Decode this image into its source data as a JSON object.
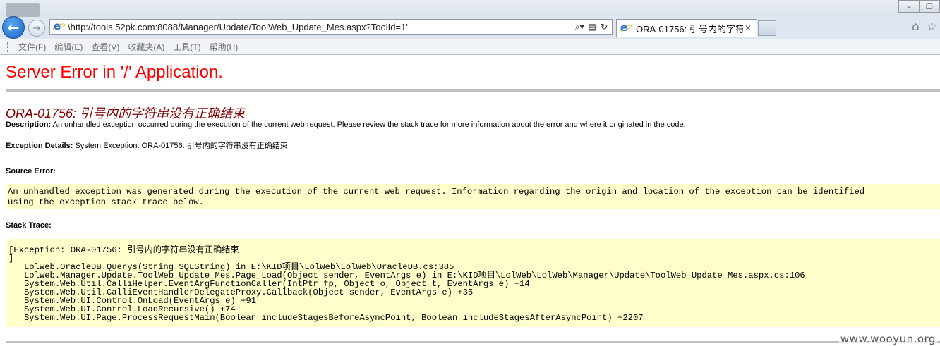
{
  "browser": {
    "address_url": "\\http://tools.52pk.com:8088/Manager/Update/ToolWeb_Update_Mes.aspx?ToolId=1'",
    "tab_title": "ORA-01756: 引号内的字符...",
    "menu": [
      "文件(F)",
      "编辑(E)",
      "查看(V)",
      "收藏夹(A)",
      "工具(T)",
      "帮助(H)"
    ]
  },
  "page": {
    "title": "Server Error in '/' Application.",
    "error_heading": "ORA-01756: 引号内的字符串没有正确结束",
    "description_label": "Description:",
    "description_text": " An unhandled exception occurred during the execution of the current web request. Please review the stack trace for more information about the error and where it originated in the code.",
    "exception_label": "Exception Details:",
    "exception_text": " System.Exception: ORA-01756: 引号内的字符串没有正确结束",
    "source_error_label": "Source Error:",
    "source_error_lines": [
      "An unhandled exception was generated during the execution of the current web request. Information regarding the origin and location of the exception can be identified",
      "using the exception stack trace below."
    ],
    "stack_trace_label": "Stack Trace:",
    "stack_trace_lines": [
      "[Exception: ORA-01756: 引号内的字符串没有正确结束",
      "]",
      "   LolWeb.OracleDB.Querys(String SQLString) in E:\\KID项目\\LolWeb\\LolWeb\\OracleDB.cs:385",
      "   LolWeb.Manager.Update.ToolWeb_Update_Mes.Page_Load(Object sender, EventArgs e) in E:\\KID项目\\LolWeb\\LolWeb\\Manager\\Update\\ToolWeb_Update_Mes.aspx.cs:106",
      "   System.Web.Util.CalliHelper.EventArgFunctionCaller(IntPtr fp, Object o, Object t, EventArgs e) +14",
      "   System.Web.Util.CalliEventHandlerDelegateProxy.Callback(Object sender, EventArgs e) +35",
      "   System.Web.UI.Control.OnLoad(EventArgs e) +91",
      "   System.Web.UI.Control.LoadRecursive() +74",
      "   System.Web.UI.Page.ProcessRequestMain(Boolean includeStagesBeforeAsyncPoint, Boolean includeStagesAfterAsyncPoint) +2207"
    ]
  },
  "watermark": "www.wooyun.org",
  "colors": {
    "title_red": "#ff0000",
    "heading_maroon": "#800000",
    "code_bg": "#ffffcc"
  },
  "icons": [
    "back-arrow-icon",
    "forward-arrow-icon",
    "ie-logo-icon",
    "search-icon",
    "compatibility-icon",
    "refresh-icon",
    "close-icon",
    "home-icon",
    "star-icon",
    "gear-icon"
  ]
}
